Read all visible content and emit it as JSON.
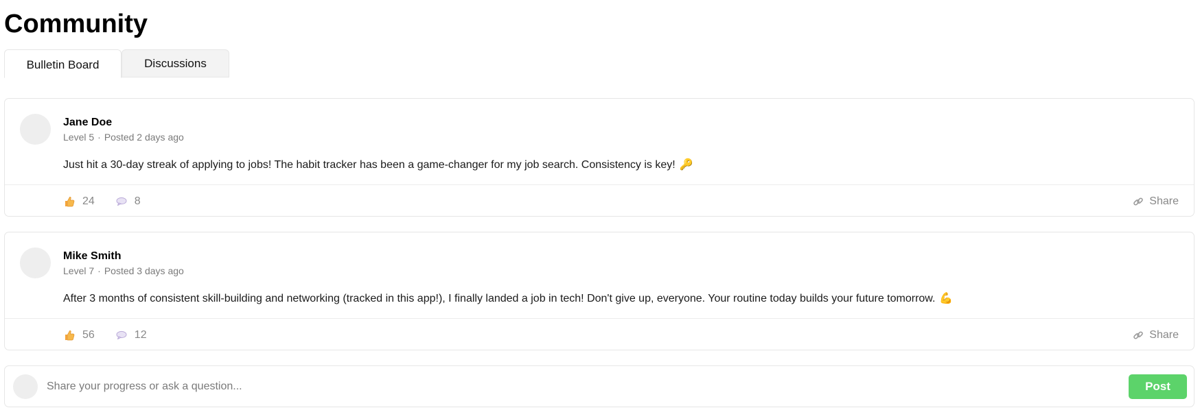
{
  "page": {
    "title": "Community"
  },
  "tabs": [
    {
      "label": "Bulletin Board",
      "active": true
    },
    {
      "label": "Discussions",
      "active": false
    }
  ],
  "posts": [
    {
      "author": "Jane Doe",
      "level": "Level 5",
      "separator": "·",
      "posted": "Posted 2 days ago",
      "text": "Just hit a 30-day streak of applying to jobs! The habit tracker has been a game-changer for my job search. Consistency is key!",
      "emoji": "🔑",
      "likes": "24",
      "comments": "8",
      "share_label": "Share"
    },
    {
      "author": "Mike Smith",
      "level": "Level 7",
      "separator": "·",
      "posted": "Posted 3 days ago",
      "text": "After 3 months of consistent skill-building and networking (tracked in this app!), I finally landed a job in tech! Don't give up, everyone. Your routine today builds your future tomorrow.",
      "emoji": "💪",
      "likes": "56",
      "comments": "12",
      "share_label": "Share"
    }
  ],
  "composer": {
    "placeholder": "Share your progress or ask a question...",
    "value": "",
    "post_label": "Post"
  },
  "icons": {
    "like": "thumbs-up-icon",
    "comment": "speech-bubble-icon",
    "share": "link-icon"
  },
  "colors": {
    "accent_green": "#5cd36a",
    "muted_text": "#888888",
    "border": "#e6e6e6",
    "avatar_placeholder": "#eeeeee"
  }
}
